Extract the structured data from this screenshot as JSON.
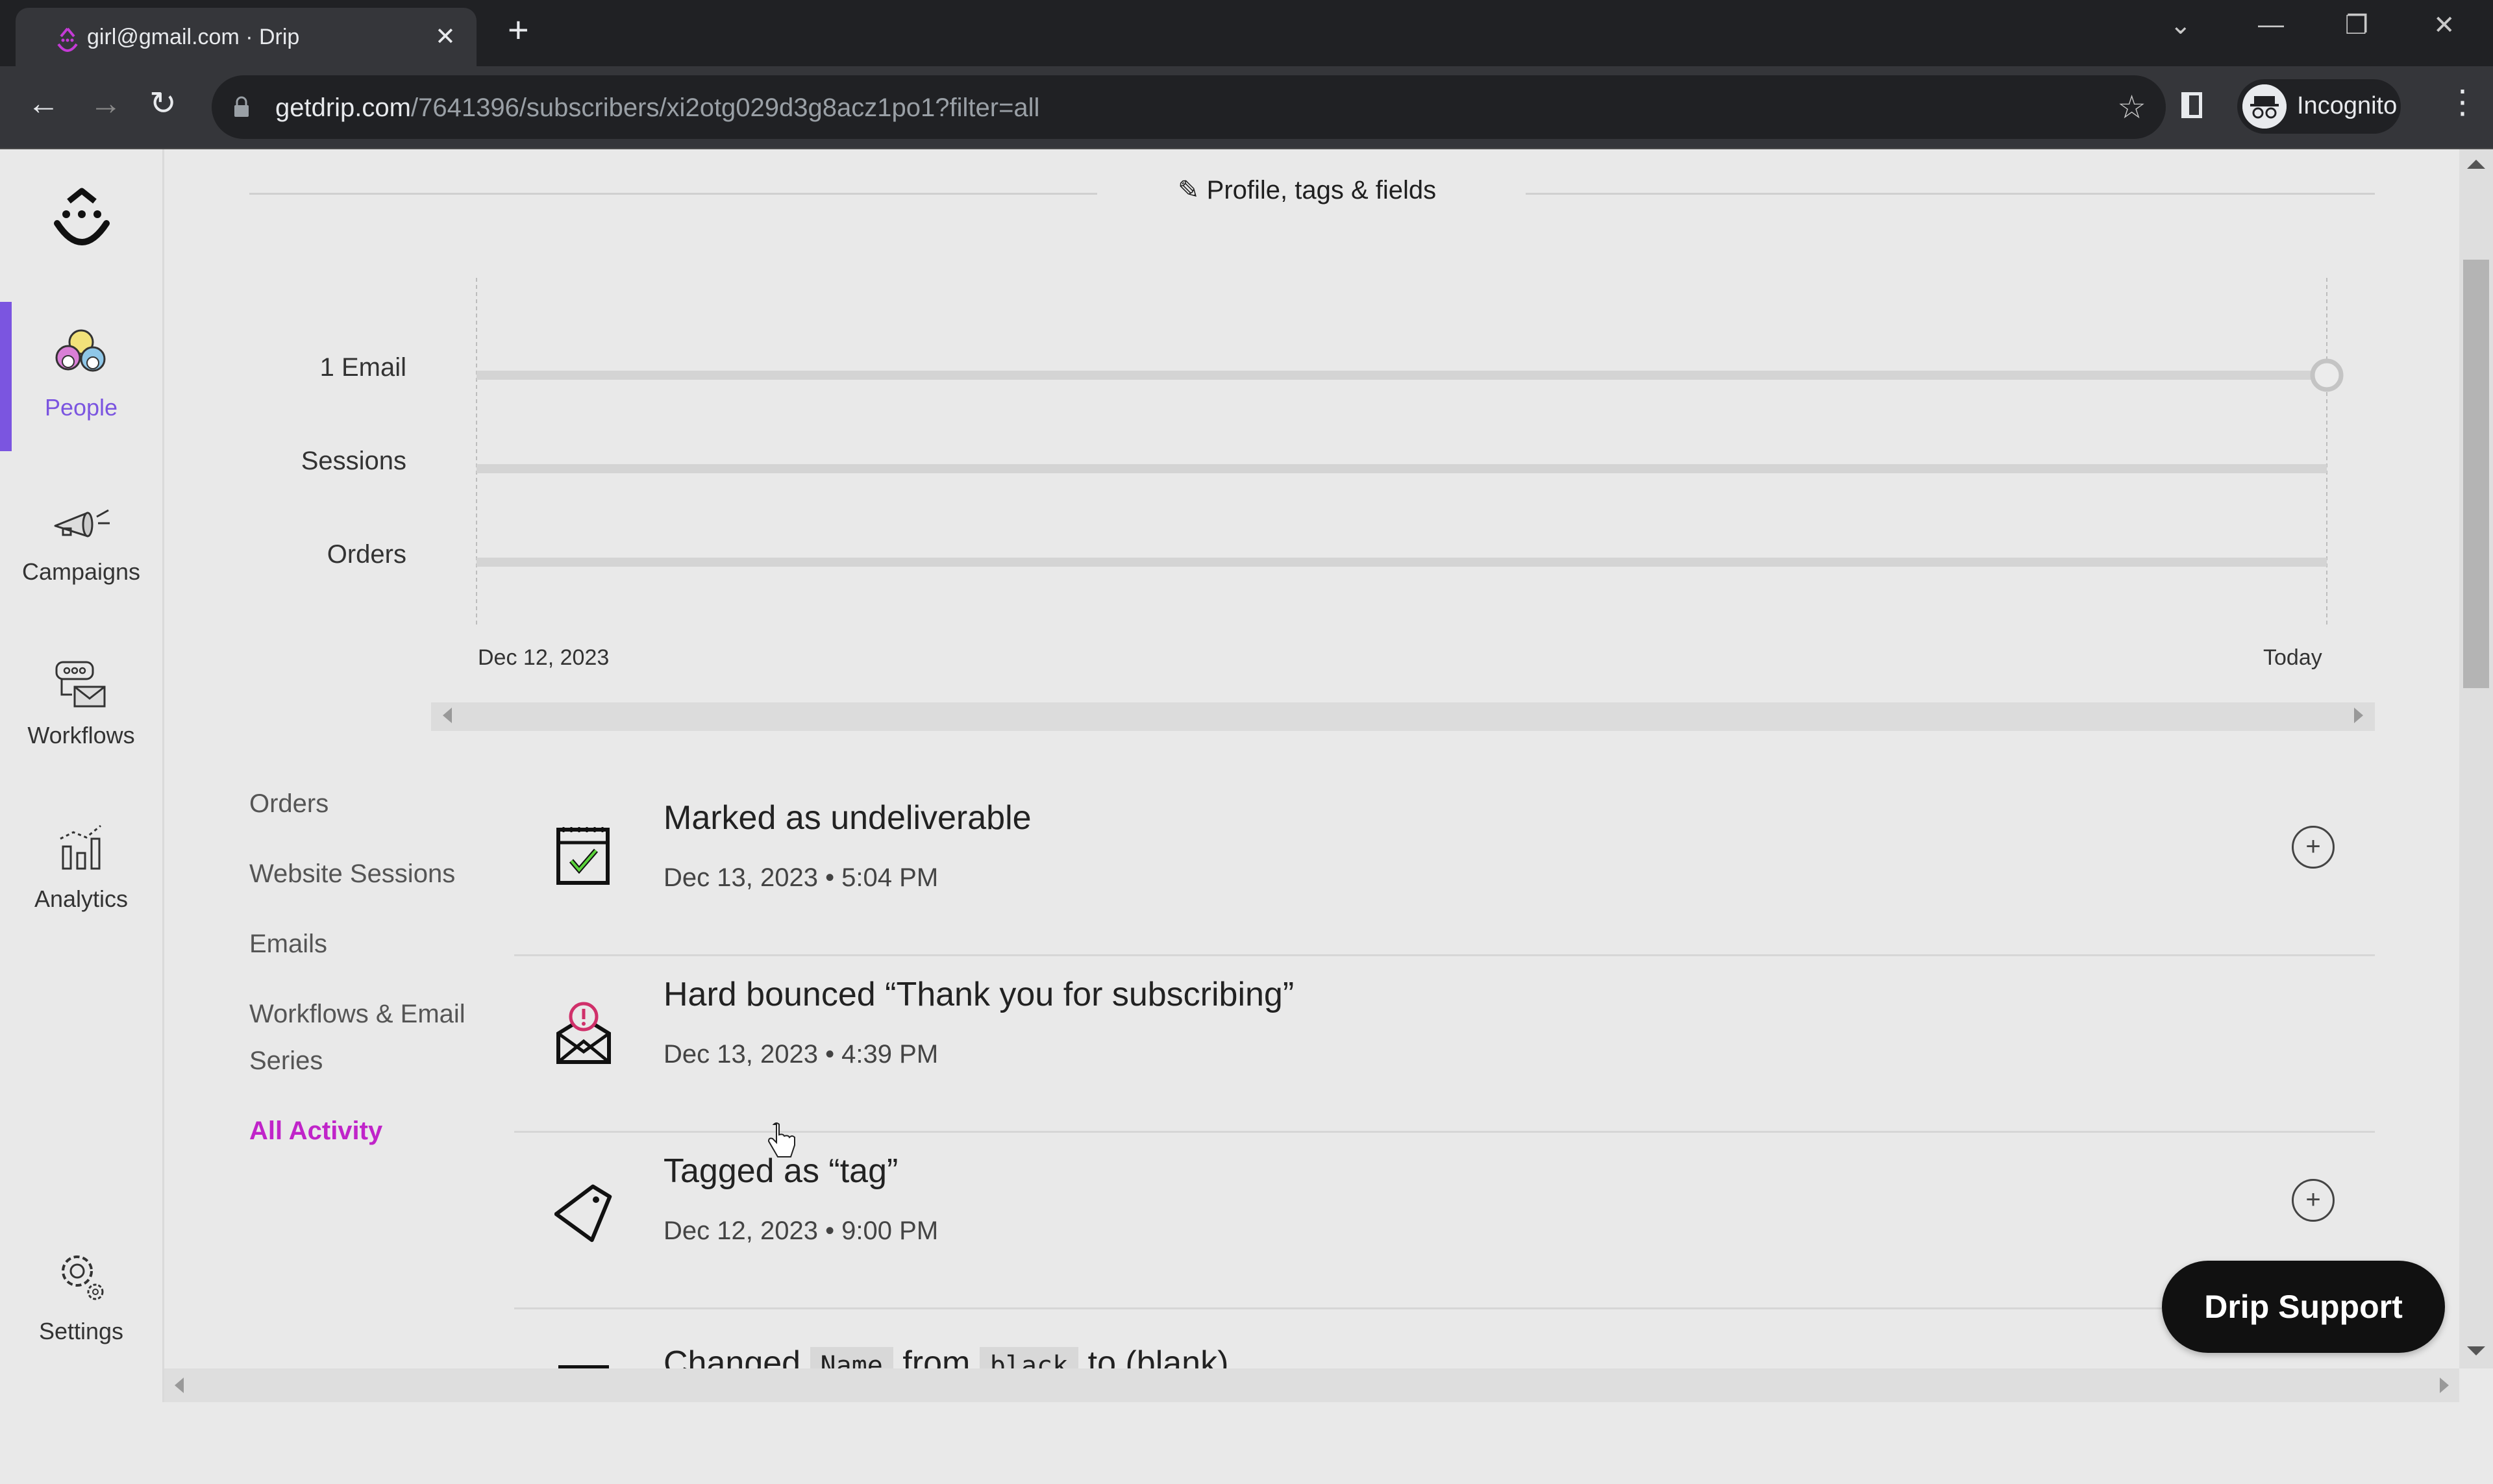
{
  "browser": {
    "tab_title": "girl@gmail.com · Drip",
    "url_host": "getdrip.com",
    "url_path": "/7641396/subscribers/xi2otg029d3g8acz1po1?filter=all",
    "profile_label": "Incognito"
  },
  "sidebar": {
    "items": [
      {
        "label": "People",
        "active": true
      },
      {
        "label": "Campaigns"
      },
      {
        "label": "Workflows"
      },
      {
        "label": "Analytics"
      },
      {
        "label": "Settings"
      }
    ],
    "accent_color": "#7b55e0"
  },
  "section": {
    "title": "Profile, tags & fields"
  },
  "chart_data": {
    "type": "timeline",
    "title": "",
    "rows": [
      {
        "label": "1 Email",
        "events": [
          {
            "x": "Today",
            "marker": "circle"
          }
        ]
      },
      {
        "label": "Sessions",
        "events": []
      },
      {
        "label": "Orders",
        "events": []
      }
    ],
    "x_axis": {
      "start_label": "Dec 12, 2023",
      "end_label": "Today"
    },
    "grid": false
  },
  "filters": {
    "items": [
      {
        "label": "Orders"
      },
      {
        "label": "Website Sessions"
      },
      {
        "label": "Emails"
      },
      {
        "label": "Workflows & Email Series"
      },
      {
        "label": "All Activity",
        "active": true
      }
    ],
    "active_color": "#c024c9"
  },
  "activity": [
    {
      "icon": "calendar-check-icon",
      "title": "Marked as undeliverable",
      "date": "Dec 13, 2023 • 5:04 PM",
      "expandable": true
    },
    {
      "icon": "email-bounce-icon",
      "title": "Hard bounced “Thank you for subscribing”",
      "date": "Dec 13, 2023 • 4:39 PM",
      "expandable": false
    },
    {
      "icon": "tag-icon",
      "title": "Tagged as “tag”",
      "date": "Dec 12, 2023 • 9:00 PM",
      "expandable": true
    },
    {
      "icon": "field-change-icon",
      "title_parts": [
        "Changed",
        "Name",
        "from",
        "black",
        "to (blank)"
      ]
    }
  ],
  "support": {
    "label": "Drip Support"
  }
}
